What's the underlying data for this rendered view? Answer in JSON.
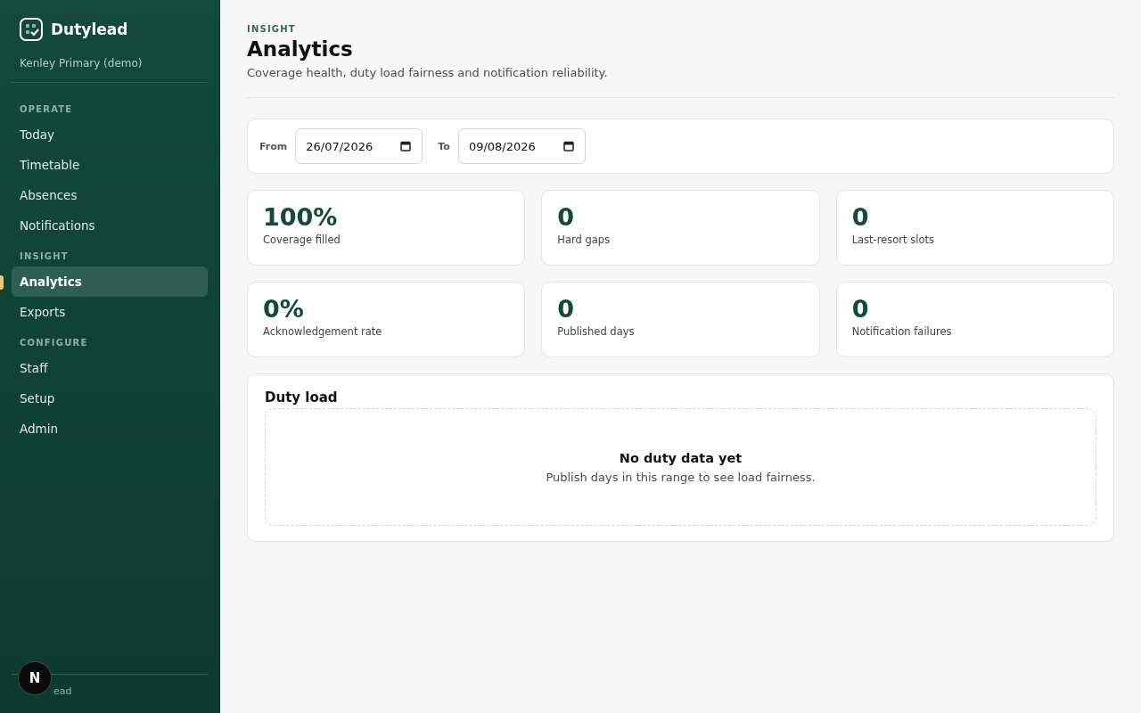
{
  "brand": {
    "name": "Dutylead",
    "school": "Kenley Primary (demo)"
  },
  "nav": [
    {
      "heading": "OPERATE",
      "items": [
        {
          "label": "Today",
          "selected": false
        },
        {
          "label": "Timetable",
          "selected": false
        },
        {
          "label": "Absences",
          "selected": false
        },
        {
          "label": "Notifications",
          "selected": false
        }
      ]
    },
    {
      "heading": "INSIGHT",
      "items": [
        {
          "label": "Analytics",
          "selected": true
        },
        {
          "label": "Exports",
          "selected": false
        }
      ]
    },
    {
      "heading": "CONFIGURE",
      "items": [
        {
          "label": "Staff",
          "selected": false
        },
        {
          "label": "Setup",
          "selected": false
        },
        {
          "label": "Admin",
          "selected": false
        }
      ]
    }
  ],
  "footer": "ead",
  "dev_badge": "N",
  "page": {
    "eyebrow": "INSIGHT",
    "title": "Analytics",
    "subtitle": "Coverage health, duty load fairness and notification reliability."
  },
  "filters": [
    {
      "label": "From",
      "value": "26/07/2026"
    },
    {
      "label": "To",
      "value": "09/08/2026"
    }
  ],
  "stats": [
    {
      "value": "100%",
      "label": "Coverage filled"
    },
    {
      "value": "0",
      "label": "Hard gaps"
    },
    {
      "value": "0",
      "label": "Last-resort slots"
    },
    {
      "value": "0%",
      "label": "Acknowledgement rate"
    },
    {
      "value": "0",
      "label": "Published days"
    },
    {
      "value": "0",
      "label": "Notification failures"
    }
  ],
  "duty_load": {
    "title": "Duty load",
    "empty_title": "No duty data yet",
    "empty_text": "Publish days in this range to see load fairness."
  }
}
